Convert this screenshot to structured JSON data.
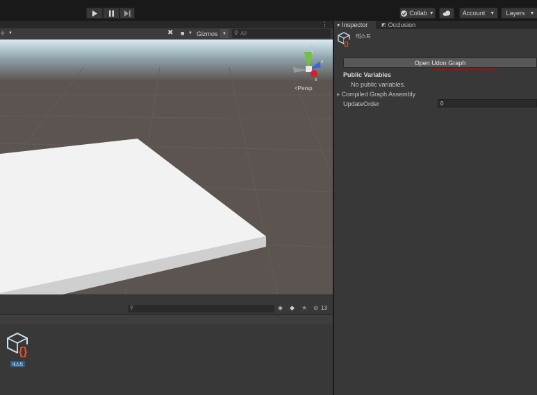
{
  "toolbar": {
    "play_icon": "play-icon",
    "pause_icon": "pause-icon",
    "step_icon": "step-icon",
    "collab_label": "Collab",
    "cloud_icon": "cloud-icon",
    "account_label": "Account",
    "layers_label": "Layers"
  },
  "scene": {
    "gizmos_label": "Gizmos",
    "search_placeholder": "All",
    "persp_label": "Persp",
    "axis_y": "y",
    "axis_z": "z",
    "axis_x": "x"
  },
  "inspector": {
    "tab_inspector": "Inspector",
    "tab_occlusion": "Occlusion",
    "asset_name": "테스트",
    "open_graph_button": "Open Udon Graph",
    "public_variables_header": "Public Variables",
    "no_public_variables": "No public variables.",
    "compiled_graph_assembly": "Compiled Graph Assembly",
    "update_order_label": "UpdateOrder",
    "update_order_value": "0",
    "annotation_color": "#cc0000"
  },
  "project": {
    "hidden_count": "13",
    "asset_label": "테스트"
  },
  "colors": {
    "accent_asset": "#e0522e",
    "selection_blue": "#2c5d87",
    "scene_ground": "#5b5450"
  }
}
